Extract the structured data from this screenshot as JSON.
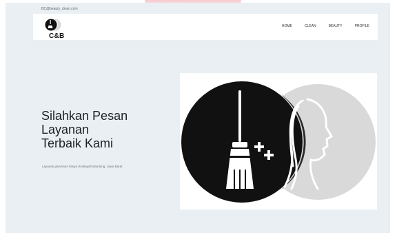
{
  "topbar": {
    "email": "BC@beauty_clean.com"
  },
  "header": {
    "logo_text": "C&B",
    "nav": [
      "HOME",
      "CLEAN",
      "BEAUTY",
      "PROFILE"
    ]
  },
  "hero": {
    "title_lines": [
      "Silahkan Pesan",
      "Layanan",
      "Terbaik Kami"
    ],
    "subtitle": "Layanan jasa kami hanya di wilayah Bandung, Jawa Barat"
  },
  "colors": {
    "page_bg": "#e9eff2",
    "accent": "#f7c9cf",
    "dark": "#111111",
    "light_circle": "#d9d9d9"
  },
  "icons": [
    "broom-icon",
    "sparkle-icon",
    "woman-face-icon",
    "logo-icon"
  ]
}
